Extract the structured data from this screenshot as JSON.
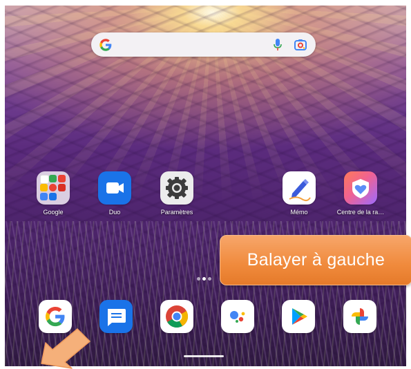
{
  "search": {
    "google_icon": "google-g-icon",
    "mic_icon": "microphone-icon",
    "lens_icon": "google-lens-icon"
  },
  "apps_row": [
    {
      "name": "google-folder",
      "label": "Google"
    },
    {
      "name": "duo",
      "label": "Duo"
    },
    {
      "name": "parametres",
      "label": "Paramètres"
    },
    {
      "name": "memo",
      "label": "Mémo"
    },
    {
      "name": "centre",
      "label": "Centre de la ra…"
    }
  ],
  "dock": [
    {
      "name": "google",
      "icon": "google-g-icon"
    },
    {
      "name": "messages",
      "icon": "messages-icon"
    },
    {
      "name": "chrome",
      "icon": "chrome-icon"
    },
    {
      "name": "assistant",
      "icon": "assistant-icon"
    },
    {
      "name": "play-store",
      "icon": "play-store-icon"
    },
    {
      "name": "photos",
      "icon": "photos-icon"
    }
  ],
  "callout": {
    "text": "Balayer à gauche"
  },
  "colors": {
    "callout": "#f08a3c",
    "arrow": "#f5b07a",
    "duo": "#1a73e8",
    "messages": "#1a73e8"
  }
}
